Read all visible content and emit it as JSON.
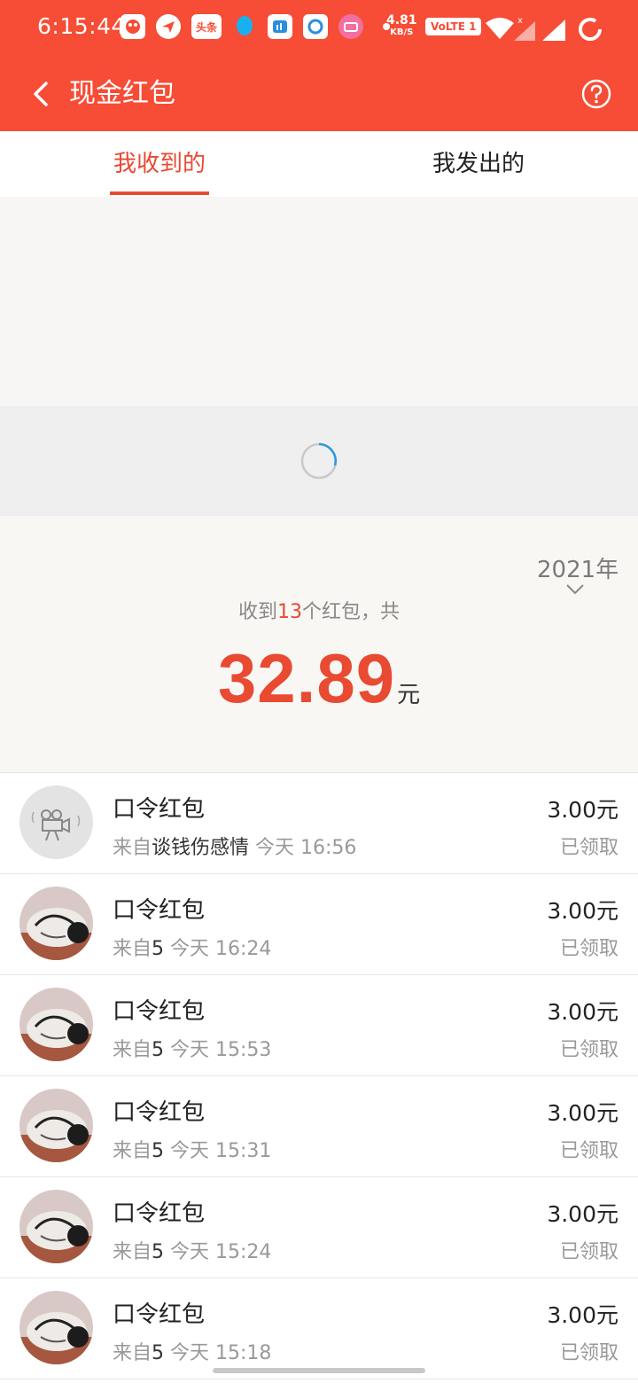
{
  "status_bar": {
    "time": "6:15:44",
    "app_icons": [
      "face-app-icon",
      "paperplane-app-icon",
      "toutiao-app-icon",
      "qq-app-icon",
      "bank-app-icon",
      "browser-app-icon",
      "bilibili-app-icon"
    ],
    "toutiao_label": "头条",
    "speed_value": "4.81",
    "speed_unit": "KB/S",
    "volte": "VoLTE 1"
  },
  "header": {
    "title": "现金红包",
    "back_icon": "back-arrow-icon",
    "help_icon": "help-circle-icon",
    "bg_color": "#f74c35"
  },
  "tabs": {
    "received": "我收到的",
    "sent": "我发出的",
    "active_color": "#e94a32"
  },
  "summary": {
    "year": "2021年",
    "prefix": "收到",
    "count": "13",
    "suffix": "个红包，共",
    "amount": "32.89",
    "unit": "元"
  },
  "records": [
    {
      "title": "口令红包",
      "from_label": "来自",
      "sender": "谈钱伤感情",
      "time": "今天 16:56",
      "amount": "3.00元",
      "status": "已领取",
      "avatar": "camera"
    },
    {
      "title": "口令红包",
      "from_label": "来自",
      "sender": "5",
      "time": "今天 16:24",
      "amount": "3.00元",
      "status": "已领取",
      "avatar": "photo"
    },
    {
      "title": "口令红包",
      "from_label": "来自",
      "sender": "5",
      "time": "今天 15:53",
      "amount": "3.00元",
      "status": "已领取",
      "avatar": "photo"
    },
    {
      "title": "口令红包",
      "from_label": "来自",
      "sender": "5",
      "time": "今天 15:31",
      "amount": "3.00元",
      "status": "已领取",
      "avatar": "photo"
    },
    {
      "title": "口令红包",
      "from_label": "来自",
      "sender": "5",
      "time": "今天 15:24",
      "amount": "3.00元",
      "status": "已领取",
      "avatar": "photo"
    },
    {
      "title": "口令红包",
      "from_label": "来自",
      "sender": "5",
      "time": "今天 15:18",
      "amount": "3.00元",
      "status": "已领取",
      "avatar": "photo"
    }
  ]
}
